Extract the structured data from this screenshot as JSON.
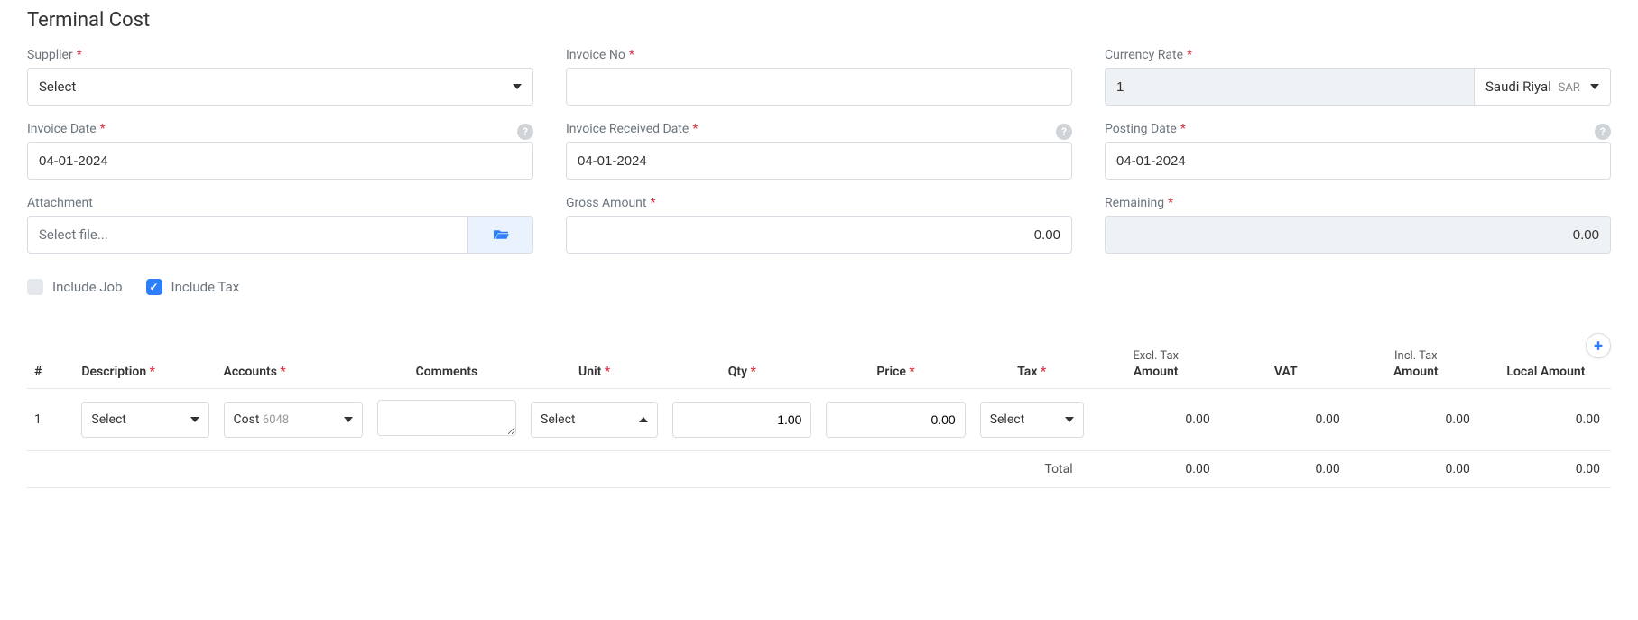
{
  "page_title": "Terminal Cost",
  "fields": {
    "supplier": {
      "label": "Supplier",
      "placeholder": "Select"
    },
    "invoice_no": {
      "label": "Invoice No",
      "value": ""
    },
    "currency_rate": {
      "label": "Currency Rate",
      "value": "1",
      "currency_name": "Saudi Riyal",
      "currency_code": "SAR"
    },
    "invoice_date": {
      "label": "Invoice Date",
      "value": "04-01-2024"
    },
    "invoice_received_date": {
      "label": "Invoice Received Date",
      "value": "04-01-2024"
    },
    "posting_date": {
      "label": "Posting Date",
      "value": "04-01-2024"
    },
    "attachment": {
      "label": "Attachment",
      "placeholder": "Select file..."
    },
    "gross_amount": {
      "label": "Gross Amount",
      "value": "0.00"
    },
    "remaining": {
      "label": "Remaining",
      "value": "0.00"
    }
  },
  "checkboxes": {
    "include_job": {
      "label": "Include Job",
      "checked": false
    },
    "include_tax": {
      "label": "Include Tax",
      "checked": true
    }
  },
  "table": {
    "headers": {
      "num": "#",
      "description": "Description",
      "accounts": "Accounts",
      "comments": "Comments",
      "unit": "Unit",
      "qty": "Qty",
      "price": "Price",
      "tax": "Tax",
      "excl_sub": "Excl. Tax",
      "excl_amount": "Amount",
      "vat": "VAT",
      "incl_sub": "Incl. Tax",
      "incl_amount": "Amount",
      "local_amount": "Local Amount"
    },
    "rows": [
      {
        "num": "1",
        "description": "Select",
        "accounts_label": "Cost",
        "accounts_code": "6048",
        "comments": "",
        "unit": "Select",
        "qty": "1.00",
        "price": "0.00",
        "tax": "Select",
        "excl_amount": "0.00",
        "vat": "0.00",
        "incl_amount": "0.00",
        "local_amount": "0.00"
      }
    ],
    "total": {
      "label": "Total",
      "excl_amount": "0.00",
      "vat": "0.00",
      "incl_amount": "0.00",
      "local_amount": "0.00"
    }
  }
}
